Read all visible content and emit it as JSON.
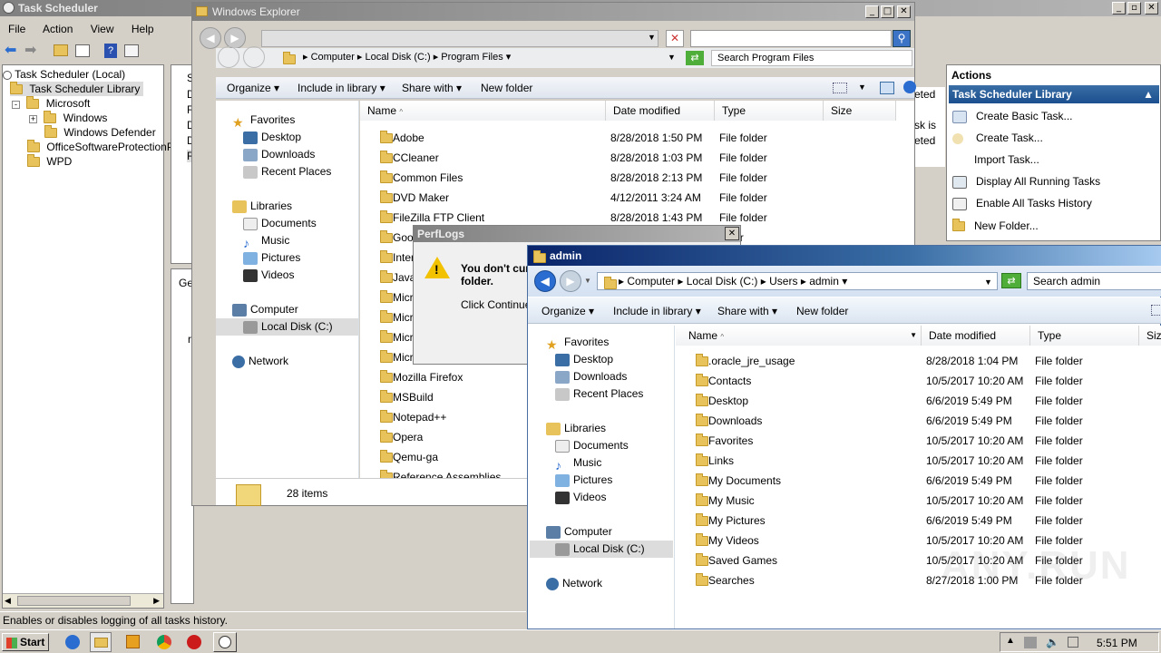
{
  "task_scheduler": {
    "title": "Task Scheduler",
    "menu": [
      "File",
      "Action",
      "View",
      "Help"
    ],
    "tree": [
      "Task Scheduler (Local)",
      "Task Scheduler Library",
      "Microsoft",
      "Windows",
      "Windows Defender",
      "OfficeSoftwareProtectionPl",
      "WPD"
    ],
    "status_rows": [
      "Statu",
      "Disab",
      "Read",
      "Disab",
      "Disab",
      "Read"
    ],
    "side_fragments": [
      "eted",
      "sk is",
      "eted"
    ],
    "lower_tab": "Gead",
    "lower_label": "rgar",
    "statusbar": "Enables or disables logging of all tasks history.",
    "actions": {
      "header": "Actions",
      "section": "Task Scheduler Library",
      "items": [
        "Create Basic Task...",
        "Create Task...",
        "Import Task...",
        "Display All Running Tasks",
        "Enable All Tasks History",
        "New Folder..."
      ]
    }
  },
  "explorer1": {
    "title": "Windows Explorer",
    "breadcrumb": [
      "Computer",
      "Local Disk (C:)",
      "Program Files"
    ],
    "search_placeholder": "Search Program Files",
    "toolbar": [
      "Organize",
      "Include in library",
      "Share with",
      "New folder"
    ],
    "columns": [
      "Name",
      "Date modified",
      "Type",
      "Size"
    ],
    "nav": {
      "favorites": "Favorites",
      "desktop": "Desktop",
      "downloads": "Downloads",
      "recent": "Recent Places",
      "libraries": "Libraries",
      "documents": "Documents",
      "music": "Music",
      "pictures": "Pictures",
      "videos": "Videos",
      "computer": "Computer",
      "localdisk": "Local Disk (C:)",
      "network": "Network"
    },
    "rows": [
      {
        "name": "Adobe",
        "date": "8/28/2018 1:50 PM",
        "type": "File folder"
      },
      {
        "name": "CCleaner",
        "date": "8/28/2018 1:03 PM",
        "type": "File folder"
      },
      {
        "name": "Common Files",
        "date": "8/28/2018 2:13 PM",
        "type": "File folder"
      },
      {
        "name": "DVD Maker",
        "date": "4/12/2011 3:24 AM",
        "type": "File folder"
      },
      {
        "name": "FileZilla FTP Client",
        "date": "8/28/2018 1:43 PM",
        "type": "File folder"
      },
      {
        "name": "Goo",
        "date": "",
        "type": "older"
      },
      {
        "name": "Inter",
        "date": "",
        "type": ""
      },
      {
        "name": "Java",
        "date": "",
        "type": ""
      },
      {
        "name": "Micro",
        "date": "",
        "type": ""
      },
      {
        "name": "Micro",
        "date": "",
        "type": ""
      },
      {
        "name": "Micro",
        "date": "",
        "type": ""
      },
      {
        "name": "Micro",
        "date": "",
        "type": ""
      },
      {
        "name": "Mozilla Firefox",
        "date": "",
        "type": ""
      },
      {
        "name": "MSBuild",
        "date": "",
        "type": ""
      },
      {
        "name": "Notepad++",
        "date": "",
        "type": ""
      },
      {
        "name": "Opera",
        "date": "",
        "type": ""
      },
      {
        "name": "Qemu-ga",
        "date": "",
        "type": ""
      },
      {
        "name": "Reference Assemblies",
        "date": "",
        "type": ""
      }
    ],
    "item_count": "28 items"
  },
  "dialog": {
    "title": "PerfLogs",
    "message": "You don't cur",
    "message2": "folder.",
    "hint": "Click Continue t"
  },
  "explorer2": {
    "title": "admin",
    "breadcrumb": [
      "Computer",
      "Local Disk (C:)",
      "Users",
      "admin"
    ],
    "search_placeholder": "Search admin",
    "toolbar": [
      "Organize",
      "Include in library",
      "Share with",
      "New folder"
    ],
    "columns": [
      "Name",
      "Date modified",
      "Type",
      "Size"
    ],
    "nav": {
      "favorites": "Favorites",
      "desktop": "Desktop",
      "downloads": "Downloads",
      "recent": "Recent Places",
      "libraries": "Libraries",
      "documents": "Documents",
      "music": "Music",
      "pictures": "Pictures",
      "videos": "Videos",
      "computer": "Computer",
      "localdisk": "Local Disk (C:)",
      "network": "Network"
    },
    "rows": [
      {
        "name": ".oracle_jre_usage",
        "date": "8/28/2018 1:04 PM",
        "type": "File folder"
      },
      {
        "name": "Contacts",
        "date": "10/5/2017 10:20 AM",
        "type": "File folder"
      },
      {
        "name": "Desktop",
        "date": "6/6/2019 5:49 PM",
        "type": "File folder"
      },
      {
        "name": "Downloads",
        "date": "6/6/2019 5:49 PM",
        "type": "File folder"
      },
      {
        "name": "Favorites",
        "date": "10/5/2017 10:20 AM",
        "type": "File folder"
      },
      {
        "name": "Links",
        "date": "10/5/2017 10:20 AM",
        "type": "File folder"
      },
      {
        "name": "My Documents",
        "date": "6/6/2019 5:49 PM",
        "type": "File folder"
      },
      {
        "name": "My Music",
        "date": "10/5/2017 10:20 AM",
        "type": "File folder"
      },
      {
        "name": "My Pictures",
        "date": "6/6/2019 5:49 PM",
        "type": "File folder"
      },
      {
        "name": "My Videos",
        "date": "10/5/2017 10:20 AM",
        "type": "File folder"
      },
      {
        "name": "Saved Games",
        "date": "10/5/2017 10:20 AM",
        "type": "File folder"
      },
      {
        "name": "Searches",
        "date": "8/27/2018 1:00 PM",
        "type": "File folder"
      }
    ]
  },
  "taskbar": {
    "start": "Start",
    "clock": "5:51 PM"
  },
  "watermark": "ANY.RUN"
}
